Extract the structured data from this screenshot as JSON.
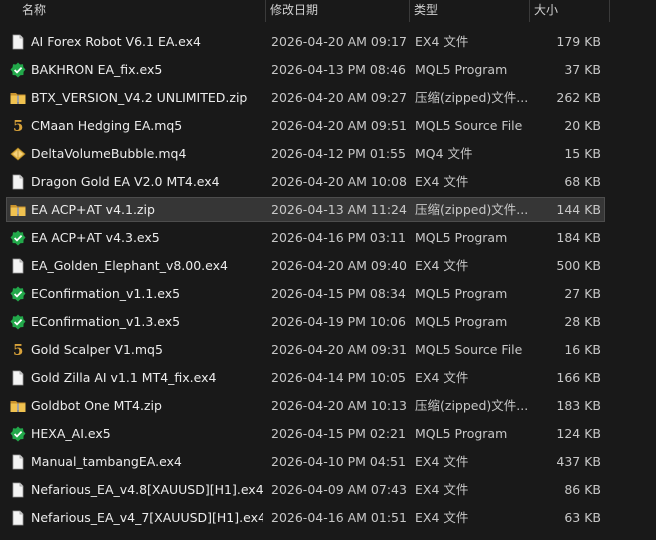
{
  "columns": {
    "name": "名称",
    "date": "修改日期",
    "type": "类型",
    "size": "大小"
  },
  "files": [
    {
      "name": "AI Forex Robot V6.1 EA.ex4",
      "date": "2026-04-20 AM 09:17",
      "type": "EX4 文件",
      "size": "179 KB",
      "icon": "document-icon"
    },
    {
      "name": "BAKHRON EA_fix.ex5",
      "date": "2026-04-13 PM 08:46",
      "type": "MQL5 Program",
      "size": "37 KB",
      "icon": "mql5-program-icon"
    },
    {
      "name": "BTX_VERSION_V4.2 UNLIMITED.zip",
      "date": "2026-04-20 AM 09:27",
      "type": "压缩(zipped)文件...",
      "size": "262 KB",
      "icon": "zip-folder-icon"
    },
    {
      "name": "CMaan Hedging EA.mq5",
      "date": "2026-04-20 AM 09:51",
      "type": "MQL5 Source File",
      "size": "20 KB",
      "icon": "mql5-source-icon"
    },
    {
      "name": "DeltaVolumeBubble.mq4",
      "date": "2026-04-12 PM 01:55",
      "type": "MQ4 文件",
      "size": "15 KB",
      "icon": "mq4-file-icon"
    },
    {
      "name": "Dragon Gold EA V2.0 MT4.ex4",
      "date": "2026-04-20 AM 10:08",
      "type": "EX4 文件",
      "size": "68 KB",
      "icon": "document-icon"
    },
    {
      "name": "EA ACP+AT v4.1.zip",
      "date": "2026-04-13 AM 11:24",
      "type": "压缩(zipped)文件...",
      "size": "144 KB",
      "icon": "zip-folder-icon",
      "selected": true
    },
    {
      "name": "EA ACP+AT v4.3.ex5",
      "date": "2026-04-16 PM 03:11",
      "type": "MQL5 Program",
      "size": "184 KB",
      "icon": "mql5-program-icon"
    },
    {
      "name": "EA_Golden_Elephant_v8.00.ex4",
      "date": "2026-04-20 AM 09:40",
      "type": "EX4 文件",
      "size": "500 KB",
      "icon": "document-icon"
    },
    {
      "name": "EConfirmation_v1.1.ex5",
      "date": "2026-04-15 PM 08:34",
      "type": "MQL5 Program",
      "size": "27 KB",
      "icon": "mql5-program-icon"
    },
    {
      "name": "EConfirmation_v1.3.ex5",
      "date": "2026-04-19 PM 10:06",
      "type": "MQL5 Program",
      "size": "28 KB",
      "icon": "mql5-program-icon"
    },
    {
      "name": "Gold Scalper V1.mq5",
      "date": "2026-04-20 AM 09:31",
      "type": "MQL5 Source File",
      "size": "16 KB",
      "icon": "mql5-source-icon"
    },
    {
      "name": "Gold Zilla AI v1.1 MT4_fix.ex4",
      "date": "2026-04-14 PM 10:05",
      "type": "EX4 文件",
      "size": "166 KB",
      "icon": "document-icon"
    },
    {
      "name": "Goldbot One MT4.zip",
      "date": "2026-04-20 AM 10:13",
      "type": "压缩(zipped)文件...",
      "size": "183 KB",
      "icon": "zip-folder-icon"
    },
    {
      "name": "HEXA_AI.ex5",
      "date": "2026-04-15 PM 02:21",
      "type": "MQL5 Program",
      "size": "124 KB",
      "icon": "mql5-program-icon"
    },
    {
      "name": "Manual_tambangEA.ex4",
      "date": "2026-04-10 PM 04:51",
      "type": "EX4 文件",
      "size": "437 KB",
      "icon": "document-icon"
    },
    {
      "name": "Nefarious_EA_v4.8[XAUUSD][H1].ex4",
      "date": "2026-04-09 AM 07:43",
      "type": "EX4 文件",
      "size": "86 KB",
      "icon": "document-icon"
    },
    {
      "name": "Nefarious_EA_v4_7[XAUUSD][H1].ex4",
      "date": "2026-04-16 AM 01:51",
      "type": "EX4 文件",
      "size": "63 KB",
      "icon": "document-icon"
    }
  ],
  "colors": {
    "background": "#191919",
    "selection": "#363636",
    "zip_folder": "#e8b84a",
    "mql5_green": "#22a84a",
    "mql5_source": "#d8a23a"
  }
}
